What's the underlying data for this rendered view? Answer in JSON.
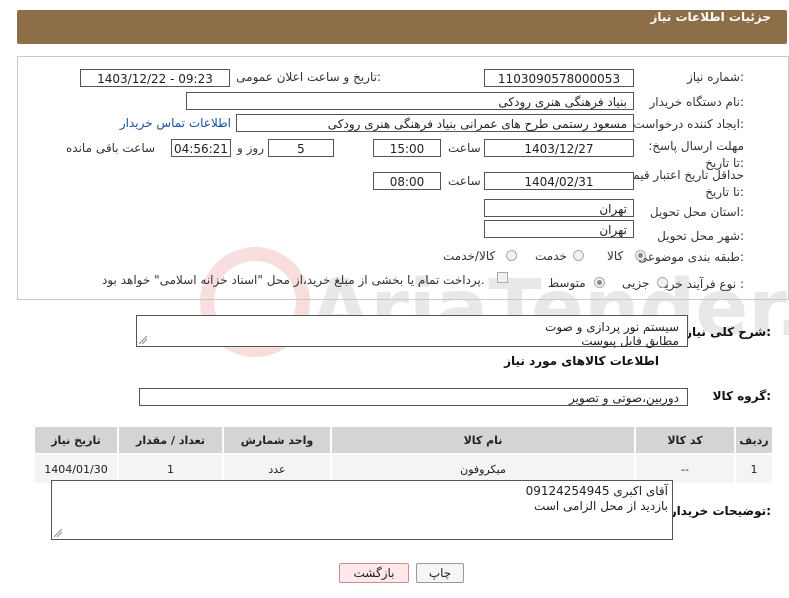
{
  "header": {
    "title": "جزئیات اطلاعات نیاز"
  },
  "form": {
    "need_number_label": "شماره نیاز:",
    "need_number": "1103090578000053",
    "announce_label": "تاریخ و ساعت اعلان عمومی:",
    "announce_value": "1403/12/22 - 09:23",
    "buyer_org_label": "نام دستگاه خریدار:",
    "buyer_org": "بنیاد فرهنگی هنری رودکی",
    "creator_label": "ایجاد کننده درخواست:",
    "creator": "مسعود رستمی طرح های عمرانی بنیاد فرهنگی هنری رودکی",
    "contact_link": "اطلاعات تماس خریدار",
    "deadline_label": "مهلت ارسال پاسخ: تا تاریخ:",
    "deadline_date": "1403/12/27",
    "time_label": "ساعت",
    "deadline_time": "15:00",
    "days": "5",
    "days_label": "روز و",
    "remaining_time": "04:56:21",
    "remaining_label": "ساعت باقی مانده",
    "validity_label": "حداقل تاریخ اعتبار قیمت: تا تاریخ:",
    "validity_date": "1404/02/31",
    "validity_time": "08:00",
    "province_label": "استان محل تحویل:",
    "province": "تهران",
    "city_label": "شهر محل تحویل:",
    "city": "تهران",
    "category_label": "طبقه بندی موضوعی:",
    "category_options": [
      "کالا",
      "خدمت",
      "کالا/خدمت"
    ],
    "process_label": "نوع فرآیند خرید :",
    "process_options": [
      "جزیی",
      "متوسط"
    ],
    "payment_note": "پرداخت تمام یا بخشی از مبلغ خرید،از محل \"اسناد خزانه اسلامی\" خواهد بود."
  },
  "description": {
    "label": "شرح کلی نیاز:",
    "line1": "سیستم نور پردازی و صوت",
    "line2": "مطابق فایل پیوست"
  },
  "goods": {
    "section_title": "اطلاعات کالاهای مورد نیاز",
    "group_label": "گروه کالا:",
    "group_value": "دوربین،صوتی و تصویر",
    "columns": [
      "ردیف",
      "کد کالا",
      "نام کالا",
      "واحد شمارش",
      "تعداد / مقدار",
      "تاریخ نیاز"
    ],
    "rows": [
      [
        "1",
        "--",
        "میکروفون",
        "عدد",
        "1",
        "1404/01/30"
      ]
    ]
  },
  "buyer_notes": {
    "label": "توضیحات خریدار:",
    "line1": "آقای اکبری 09124254945",
    "line2": "بازدید از محل الزامی است"
  },
  "buttons": {
    "print": "چاپ",
    "back": "بازگشت"
  },
  "watermark": {
    "text": "AriaTender.neT"
  },
  "colors": {
    "header": "#8c6e47",
    "link": "#1a4fa8"
  }
}
